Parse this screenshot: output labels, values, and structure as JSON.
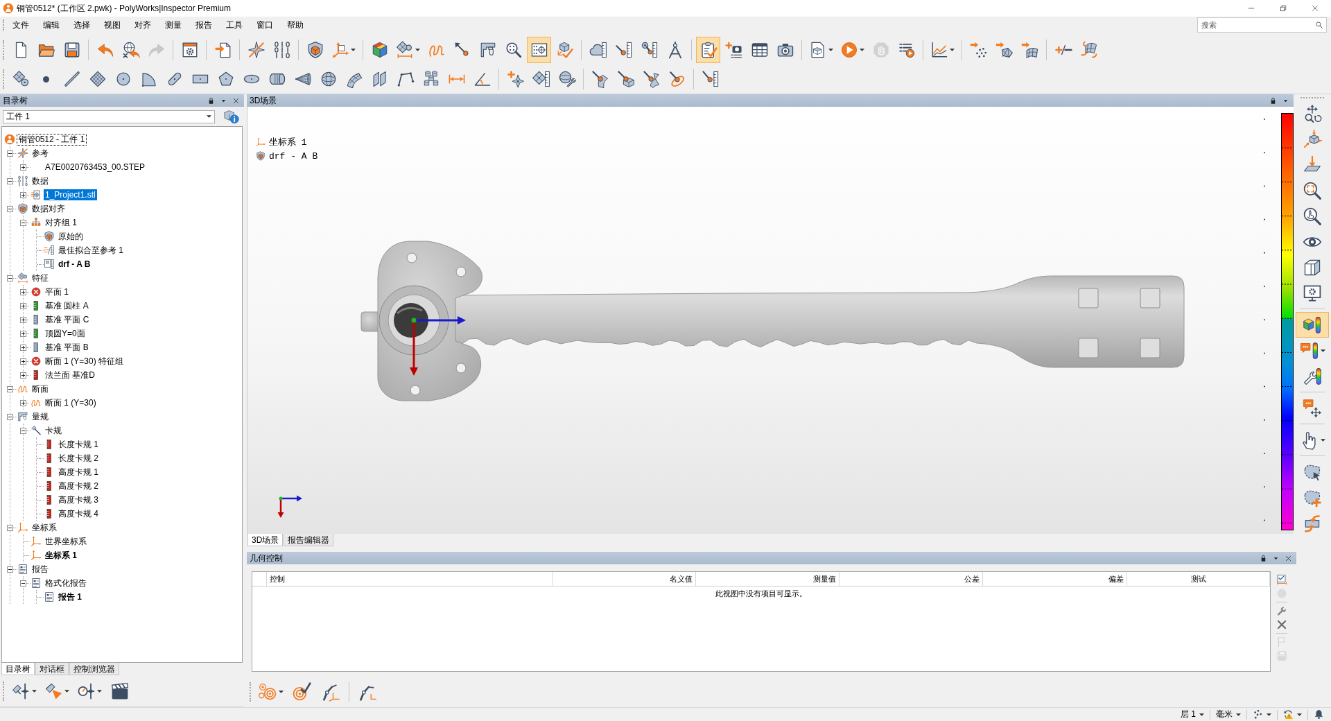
{
  "window": {
    "title": "铜管0512* (工作区 2.pwk) - PolyWorks|Inspector Premium"
  },
  "menu": [
    "文件",
    "编辑",
    "选择",
    "视图",
    "对齐",
    "测量",
    "报告",
    "工具",
    "窗口",
    "帮助"
  ],
  "search": {
    "placeholder": "搜索"
  },
  "toolbars": [
    [
      [
        {
          "selected": false,
          "disabled": false,
          "dropdown": false
        },
        {
          "selected": false,
          "disabled": false,
          "dropdown": false
        },
        {
          "selected": false,
          "disabled": false,
          "dropdown": false
        }
      ],
      [
        {
          "selected": false,
          "disabled": false,
          "dropdown": false
        },
        {
          "selected": false,
          "disabled": false,
          "dropdown": false
        },
        {
          "selected": false,
          "disabled": true,
          "dropdown": false
        }
      ],
      [
        {
          "selected": false,
          "disabled": false,
          "dropdown": false
        }
      ],
      [
        {
          "selected": false,
          "disabled": false,
          "dropdown": false
        }
      ],
      [
        {
          "selected": false,
          "disabled": false,
          "dropdown": false
        },
        {
          "selected": false,
          "disabled": false,
          "dropdown": false
        }
      ],
      [
        {
          "selected": false,
          "disabled": false,
          "dropdown": false
        },
        {
          "selected": false,
          "disabled": false,
          "dropdown": true
        }
      ],
      [
        {
          "selected": false,
          "disabled": false,
          "dropdown": false
        },
        {
          "selected": false,
          "disabled": false,
          "dropdown": true
        },
        {
          "selected": false,
          "disabled": false,
          "dropdown": false
        },
        {
          "selected": false,
          "disabled": false,
          "dropdown": false
        },
        {
          "selected": false,
          "disabled": false,
          "dropdown": false
        },
        {
          "selected": false,
          "disabled": false,
          "dropdown": false
        },
        {
          "selected": true,
          "disabled": false,
          "dropdown": false
        },
        {
          "selected": false,
          "disabled": false,
          "dropdown": false
        }
      ],
      [
        {
          "selected": false,
          "disabled": false,
          "dropdown": false
        },
        {
          "selected": false,
          "disabled": false,
          "dropdown": false
        },
        {
          "selected": false,
          "disabled": false,
          "dropdown": false
        },
        {
          "selected": false,
          "disabled": false,
          "dropdown": false
        }
      ],
      [
        {
          "selected": true,
          "disabled": false,
          "dropdown": false
        },
        {
          "selected": false,
          "disabled": false,
          "dropdown": false
        },
        {
          "selected": false,
          "disabled": false,
          "dropdown": false
        },
        {
          "selected": false,
          "disabled": false,
          "dropdown": false
        }
      ],
      [
        {
          "selected": false,
          "disabled": false,
          "dropdown": true
        },
        {
          "selected": false,
          "disabled": false,
          "dropdown": true
        },
        {
          "selected": false,
          "disabled": true,
          "dropdown": false
        },
        {
          "selected": false,
          "disabled": false,
          "dropdown": false
        }
      ],
      [
        {
          "selected": false,
          "disabled": false,
          "dropdown": true
        }
      ],
      [
        {
          "selected": false,
          "disabled": false,
          "dropdown": false
        },
        {
          "selected": false,
          "disabled": false,
          "dropdown": false
        },
        {
          "selected": false,
          "disabled": false,
          "dropdown": false
        }
      ],
      [
        {
          "selected": false,
          "disabled": false,
          "dropdown": false
        },
        {
          "selected": false,
          "disabled": false,
          "dropdown": false
        }
      ]
    ],
    [
      [
        {
          "selected": false,
          "disabled": false,
          "dropdown": false
        },
        {
          "selected": false,
          "disabled": false,
          "dropdown": false
        },
        {
          "selected": false,
          "disabled": false,
          "dropdown": false
        },
        {
          "selected": false,
          "disabled": false,
          "dropdown": false
        },
        {
          "selected": false,
          "disabled": false,
          "dropdown": false
        },
        {
          "selected": false,
          "disabled": false,
          "dropdown": false
        },
        {
          "selected": false,
          "disabled": false,
          "dropdown": false
        },
        {
          "selected": false,
          "disabled": false,
          "dropdown": false
        },
        {
          "selected": false,
          "disabled": false,
          "dropdown": false
        },
        {
          "selected": false,
          "disabled": false,
          "dropdown": false
        },
        {
          "selected": false,
          "disabled": false,
          "dropdown": false
        },
        {
          "selected": false,
          "disabled": false,
          "dropdown": false
        },
        {
          "selected": false,
          "disabled": false,
          "dropdown": false
        },
        {
          "selected": false,
          "disabled": false,
          "dropdown": false
        },
        {
          "selected": false,
          "disabled": false,
          "dropdown": false
        },
        {
          "selected": false,
          "disabled": false,
          "dropdown": false
        },
        {
          "selected": false,
          "disabled": false,
          "dropdown": false
        },
        {
          "selected": false,
          "disabled": false,
          "dropdown": false
        },
        {
          "selected": false,
          "disabled": false,
          "dropdown": false
        }
      ],
      [
        {
          "selected": false,
          "disabled": false,
          "dropdown": false
        },
        {
          "selected": false,
          "disabled": false,
          "dropdown": false
        },
        {
          "selected": false,
          "disabled": false,
          "dropdown": false
        }
      ],
      [
        {
          "selected": false,
          "disabled": false,
          "dropdown": false
        },
        {
          "selected": false,
          "disabled": false,
          "dropdown": false
        },
        {
          "selected": false,
          "disabled": false,
          "dropdown": false
        },
        {
          "selected": false,
          "disabled": false,
          "dropdown": false
        }
      ],
      [
        {
          "selected": false,
          "disabled": false,
          "dropdown": false
        }
      ]
    ]
  ],
  "tree_panel": {
    "title": "目录树",
    "selector": {
      "value": "工件 1"
    },
    "root": {
      "label": "铜管0512 - 工件 1",
      "focused": true
    },
    "nodes": [
      {
        "label": "参考",
        "kind": "reference-folder",
        "expanded": true,
        "selected": false,
        "active": false,
        "children": [
          {
            "label": "A7E0020763453_00.STEP",
            "kind": "step-file",
            "expanded": false,
            "selected": false,
            "active": false
          }
        ]
      },
      {
        "label": "数据",
        "kind": "data-folder",
        "expanded": true,
        "selected": false,
        "active": false,
        "children": [
          {
            "label": "1_Project1.stl",
            "kind": "mesh",
            "expanded": false,
            "selected": true,
            "active": false
          }
        ]
      },
      {
        "label": "数据对齐",
        "kind": "alignment-folder",
        "expanded": true,
        "selected": false,
        "active": false,
        "children": [
          {
            "label": "对齐组 1",
            "kind": "alignment-group",
            "expanded": true,
            "selected": false,
            "active": false,
            "children": [
              {
                "label": "原始的",
                "kind": "original",
                "selected": false,
                "active": false
              },
              {
                "label": "最佳拟合至参考 1",
                "kind": "best-fit",
                "selected": false,
                "active": false
              },
              {
                "label": "drf - A B",
                "kind": "datum-alignment",
                "selected": false,
                "active": true
              }
            ]
          }
        ]
      },
      {
        "label": "特征",
        "kind": "features-folder",
        "expanded": true,
        "selected": false,
        "active": false,
        "children": [
          {
            "label": "平面 1",
            "kind": "feature-error",
            "expanded": false,
            "selected": false,
            "active": false
          },
          {
            "label": "基准 圆柱 A",
            "kind": "feature",
            "color": "#2e9a2e",
            "expanded": false,
            "selected": false,
            "active": false
          },
          {
            "label": "基准 平面 C",
            "kind": "feature",
            "color": "#8da4be",
            "expanded": false,
            "selected": false,
            "active": false
          },
          {
            "label": "顶圆Y=0面",
            "kind": "feature",
            "color": "#2e9a2e",
            "expanded": false,
            "selected": false,
            "active": false
          },
          {
            "label": "基准 平面 B",
            "kind": "feature",
            "color": "#8da4be",
            "expanded": false,
            "selected": false,
            "active": false
          },
          {
            "label": "断面 1 (Y=30) 特征组",
            "kind": "feature-error",
            "expanded": false,
            "selected": false,
            "active": false
          },
          {
            "label": "法兰面 基准D",
            "kind": "feature",
            "color": "#c0281e",
            "expanded": false,
            "selected": false,
            "active": false
          }
        ]
      },
      {
        "label": "断面",
        "kind": "sections-folder",
        "expanded": true,
        "selected": false,
        "active": false,
        "children": [
          {
            "label": "断面 1 (Y=30)",
            "kind": "section",
            "expanded": false,
            "selected": false,
            "active": false
          }
        ]
      },
      {
        "label": "量规",
        "kind": "gauges-folder",
        "expanded": true,
        "selected": false,
        "active": false,
        "children": [
          {
            "label": "卡规",
            "kind": "calipers",
            "expanded": true,
            "selected": false,
            "active": false,
            "children": [
              {
                "label": "长度卡规 1",
                "kind": "gauge",
                "color": "#c0281e",
                "selected": false,
                "active": false
              },
              {
                "label": "长度卡规 2",
                "kind": "gauge",
                "color": "#c0281e",
                "selected": false,
                "active": false
              },
              {
                "label": "高度卡规 1",
                "kind": "gauge",
                "color": "#c0281e",
                "selected": false,
                "active": false
              },
              {
                "label": "高度卡规 2",
                "kind": "gauge",
                "color": "#c0281e",
                "selected": false,
                "active": false
              },
              {
                "label": "高度卡规 3",
                "kind": "gauge",
                "color": "#c0281e",
                "selected": false,
                "active": false
              },
              {
                "label": "高度卡规 4",
                "kind": "gauge",
                "color": "#c0281e",
                "selected": false,
                "active": false
              }
            ]
          }
        ]
      },
      {
        "label": "坐标系",
        "kind": "coords-folder",
        "expanded": true,
        "selected": false,
        "active": false,
        "children": [
          {
            "label": "世界坐标系",
            "kind": "coords",
            "selected": false,
            "active": false
          },
          {
            "label": "坐标系 1",
            "kind": "coords",
            "selected": false,
            "active": true
          }
        ]
      },
      {
        "label": "报告",
        "kind": "reports-folder",
        "expanded": true,
        "selected": false,
        "active": false,
        "children": [
          {
            "label": "格式化报告",
            "kind": "formatted-report",
            "expanded": true,
            "selected": false,
            "active": false,
            "children": [
              {
                "label": "报告 1",
                "kind": "report",
                "selected": false,
                "active": true
              }
            ]
          }
        ]
      }
    ],
    "tabs": [
      {
        "label": "目录树",
        "selected": true
      },
      {
        "label": "对话框",
        "selected": false
      },
      {
        "label": "控制浏览器",
        "selected": false
      }
    ],
    "toolbar": [
      [
        {
          "selected": false,
          "disabled": false,
          "dropdown": true
        },
        {
          "selected": false,
          "disabled": false,
          "dropdown": true
        },
        {
          "selected": false,
          "disabled": false,
          "dropdown": true
        },
        {
          "selected": false,
          "disabled": false,
          "dropdown": false
        }
      ]
    ]
  },
  "scene_panel": {
    "title": "3D场景",
    "legend": [
      {
        "label": "坐标系 1",
        "kind": "coordinate-system"
      },
      {
        "label": "drf - A B",
        "kind": "alignment"
      }
    ],
    "tabs": [
      {
        "label": "3D场景",
        "selected": true
      },
      {
        "label": "报告编辑器",
        "selected": false
      }
    ],
    "toolbar": [
      [
        {
          "selected": false,
          "disabled": false,
          "dropdown": false
        },
        {
          "selected": false,
          "disabled": false,
          "dropdown": false
        },
        {
          "selected": false,
          "disabled": false,
          "dropdown": false
        },
        {
          "selected": false,
          "disabled": false,
          "dropdown": false
        },
        {
          "selected": false,
          "disabled": false,
          "dropdown": false
        },
        {
          "selected": false,
          "disabled": false,
          "dropdown": false
        },
        {
          "selected": false,
          "disabled": false,
          "dropdown": false
        },
        {
          "selected": false,
          "disabled": false,
          "dropdown": false
        }
      ],
      [
        {
          "selected": true,
          "disabled": false,
          "dropdown": false
        },
        {
          "selected": false,
          "disabled": false,
          "dropdown": true
        },
        {
          "selected": false,
          "disabled": false,
          "dropdown": false
        }
      ],
      [
        {
          "selected": false,
          "disabled": false,
          "dropdown": false
        }
      ],
      [
        {
          "selected": false,
          "disabled": false,
          "dropdown": true
        }
      ],
      [
        {
          "selected": false,
          "disabled": false,
          "dropdown": false
        },
        {
          "selected": false,
          "disabled": false,
          "dropdown": false
        },
        {
          "selected": false,
          "disabled": false,
          "dropdown": false
        }
      ]
    ]
  },
  "geometry_panel": {
    "title": "几何控制",
    "columns": [
      "控制",
      "名义值",
      "测量值",
      "公差",
      "偏差",
      "测试"
    ],
    "empty_message": "此视图中没有项目可显示。",
    "side_tools": [
      [
        {
          "selected": false,
          "disabled": false,
          "dropdown": false
        },
        {
          "selected": false,
          "disabled": true,
          "dropdown": false
        }
      ],
      [
        {
          "selected": false,
          "disabled": false,
          "dropdown": false
        },
        {
          "selected": false,
          "disabled": false,
          "dropdown": false
        }
      ],
      [
        {
          "selected": false,
          "disabled": true,
          "dropdown": false
        },
        {
          "selected": false,
          "disabled": true,
          "dropdown": false
        }
      ]
    ],
    "toolbar": [
      [
        {
          "selected": false,
          "disabled": false,
          "dropdown": true
        },
        {
          "selected": false,
          "disabled": false,
          "dropdown": false
        },
        {
          "selected": false,
          "disabled": false,
          "dropdown": false
        }
      ],
      [
        {
          "selected": false,
          "disabled": false,
          "dropdown": false
        }
      ]
    ]
  },
  "status_bar": [
    {
      "kind": "text",
      "label": "层 1",
      "dropdown": true
    },
    {
      "kind": "text",
      "label": "毫米",
      "dropdown": true
    },
    {
      "kind": "icon",
      "dropdown": true
    },
    {
      "kind": "icon",
      "dropdown": true
    },
    {
      "kind": "icon",
      "dropdown": false
    }
  ]
}
